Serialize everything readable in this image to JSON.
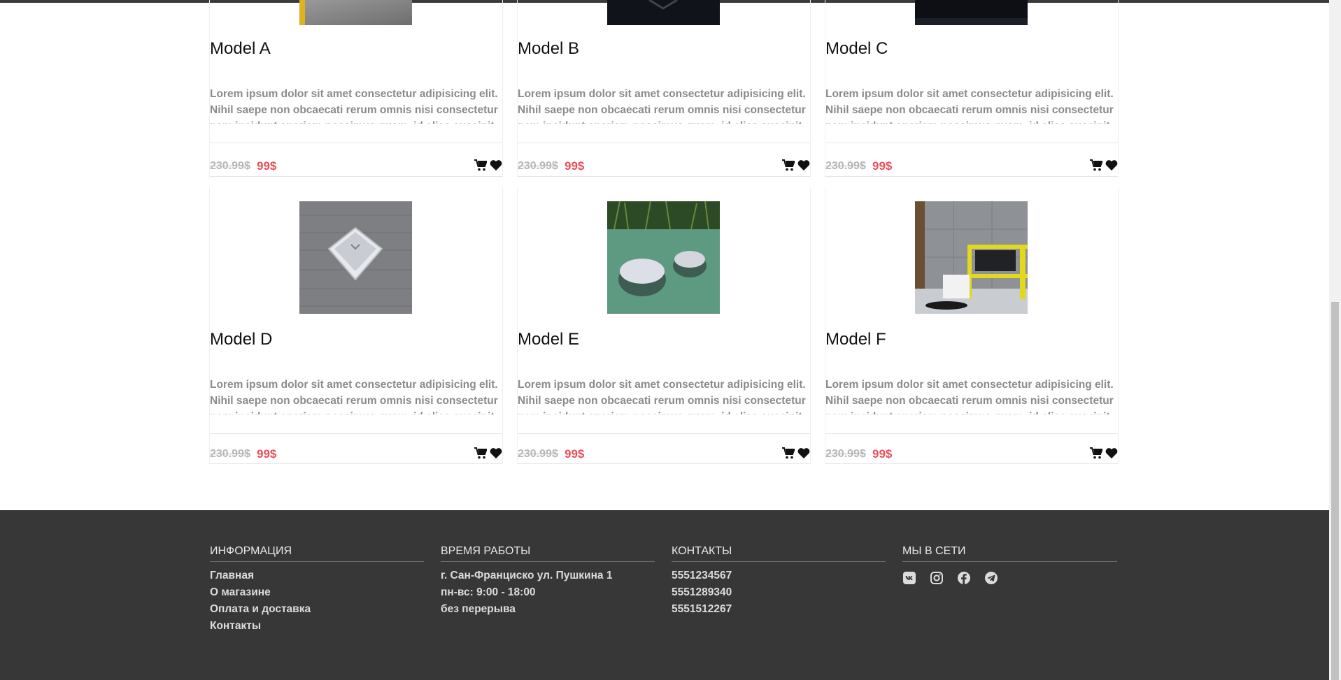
{
  "products": [
    {
      "title": "Model A",
      "description": "Lorem ipsum dolor sit amet consectetur adipisicing elit. Nihil saepe non obcaecati rerum omnis nisi consectetur nam incidunt aperiam possimus quam, id alias suscipit",
      "old_price": "230.99$",
      "new_price": "99$",
      "image": "gray-metal-product"
    },
    {
      "title": "Model B",
      "description": "Lorem ipsum dolor sit amet consectetur adipisicing elit. Nihil saepe non obcaecati rerum omnis nisi consectetur nam incidunt aperiam possimus quam, id alias suscipit",
      "old_price": "230.99$",
      "new_price": "99$",
      "image": "dark-product"
    },
    {
      "title": "Model C",
      "description": "Lorem ipsum dolor sit amet consectetur adipisicing elit. Nihil saepe non obcaecati rerum omnis nisi consectetur nam incidunt aperiam possimus quam, id alias suscipit",
      "old_price": "230.99$",
      "new_price": "99$",
      "image": "dark-product"
    },
    {
      "title": "Model D",
      "description": "Lorem ipsum dolor sit amet consectetur adipisicing elit. Nihil saepe non obcaecati rerum omnis nisi consectetur nam incidunt aperiam possimus quam, id alias suscipit",
      "old_price": "230.99$",
      "new_price": "99$",
      "image": "silver-device-on-wood"
    },
    {
      "title": "Model E",
      "description": "Lorem ipsum dolor sit amet consectetur adipisicing elit. Nihil saepe non obcaecati rerum omnis nisi consectetur nam incidunt aperiam possimus quam, id alias suscipit",
      "old_price": "230.99$",
      "new_price": "99$",
      "image": "pool-speakers"
    },
    {
      "title": "Model F",
      "description": "Lorem ipsum dolor sit amet consectetur adipisicing elit. Nihil saepe non obcaecati rerum omnis nisi consectetur nam incidunt aperiam possimus quam, id alias suscipit",
      "old_price": "230.99$",
      "new_price": "99$",
      "image": "interior-shelf"
    }
  ],
  "icons": {
    "cart": "cart-icon",
    "favorite": "heart-icon"
  },
  "colors": {
    "new_price": "#e8505b",
    "old_price": "#b7b7b7",
    "footer_bg": "#373737"
  },
  "footer": {
    "info": {
      "heading": "Информация",
      "links": [
        "Главная",
        "О магазине",
        "Оплата и доставка",
        "Контакты"
      ]
    },
    "hours": {
      "heading": "Время работы",
      "lines": [
        "г. Сан-Франциско ул. Пушкина 1",
        "пн-вс: 9:00 - 18:00",
        "без перерыва"
      ]
    },
    "contacts": {
      "heading": "Контакты",
      "phones": [
        "5551234567",
        "5551289340",
        "5551512267"
      ]
    },
    "social": {
      "heading": "Мы в сети",
      "icons": [
        "vk-icon",
        "instagram-icon",
        "facebook-icon",
        "telegram-icon"
      ]
    }
  }
}
